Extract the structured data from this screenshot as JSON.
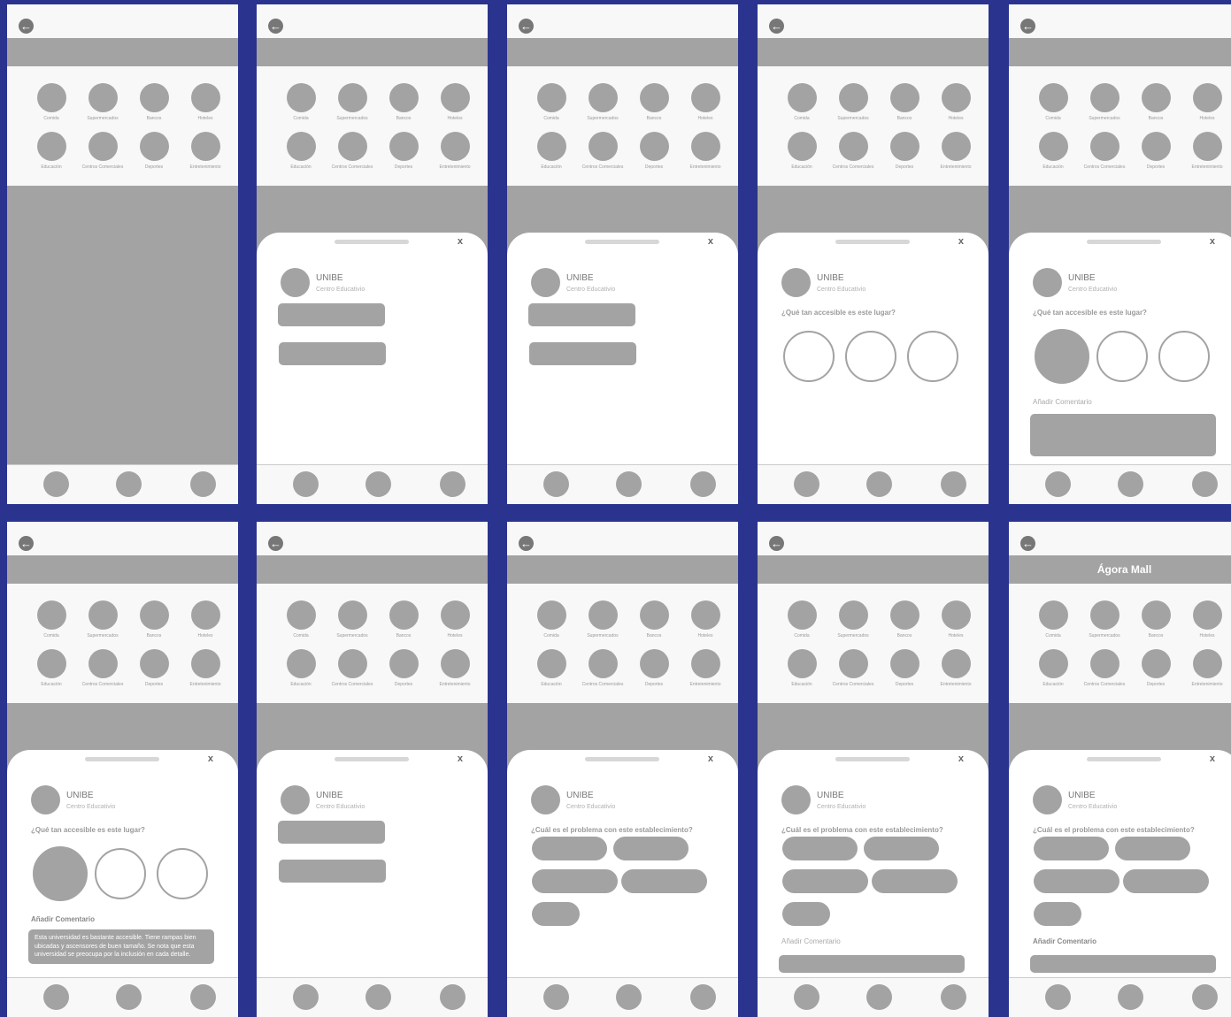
{
  "colors": {
    "background": "#2a348e",
    "placeholder": "#a3a3a3",
    "panel": "#f8f8f8"
  },
  "icons": {
    "back": "arrow-left-icon",
    "close": "close-icon"
  },
  "back_glyph": "←",
  "categories": [
    "Comida",
    "Supermercados",
    "Bancos",
    "Hoteles",
    "Educación",
    "Centros Comerciales",
    "Deportes",
    "Entretenimiento"
  ],
  "place": {
    "name": "UNIBE",
    "type": "Centro Educativio"
  },
  "close_label": "x",
  "accessibility_question": "¿Qué tan accesible es este lugar?",
  "problem_question": "¿Cuál es el problema con este establecimiento?",
  "comment_label": "Añadir Comentario",
  "comment_text": "Esta universidad es bastante accesible. Tiene rampas bien ubicadas y ascensores de buen tamaño. Se nota que esta universidad se preocupa por la inclusión en cada detalle.",
  "band_title_last": "Ágora Mall",
  "frames": [
    {
      "sheet": "none"
    },
    {
      "sheet": "options"
    },
    {
      "sheet": "options"
    },
    {
      "sheet": "rating",
      "selected": 0,
      "comment": "none"
    },
    {
      "sheet": "rating",
      "selected": 1,
      "comment": "label-box"
    },
    {
      "sheet": "rating",
      "selected": 1,
      "comment": "bold-text"
    },
    {
      "sheet": "options"
    },
    {
      "sheet": "problem",
      "comment": "none"
    },
    {
      "sheet": "problem",
      "comment": "label-box"
    },
    {
      "sheet": "problem",
      "comment": "bold-box"
    }
  ]
}
